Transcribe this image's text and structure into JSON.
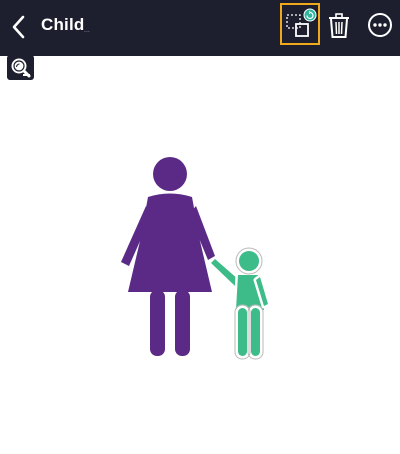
{
  "header": {
    "title": "Child",
    "title_suffix": "..."
  },
  "icons": {
    "back": "chevron-left-icon",
    "replace": "replace-image-icon",
    "delete": "trash-icon",
    "more": "more-options-icon",
    "zoom": "zoom-search-icon"
  },
  "colors": {
    "header_bg": "#1d1f2e",
    "selection_highlight": "#f0a81c",
    "badge_accent": "#2fb5a0",
    "adult_figure": "#5b2a86",
    "child_figure": "#3dbb88"
  },
  "canvas": {
    "image_description_name": "parent-and-child-clipart"
  }
}
